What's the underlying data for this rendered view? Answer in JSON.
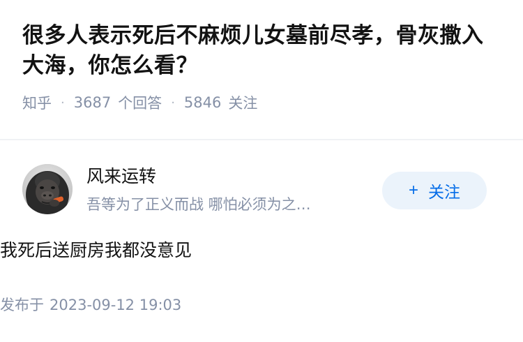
{
  "question": {
    "title": "很多人表示死后不麻烦儿女墓前尽孝，骨灰撒入大海，你怎么看？",
    "source": "知乎",
    "answers_count": "3687",
    "answers_label": "个回答",
    "followers_count": "5846",
    "followers_label": "关注"
  },
  "answer": {
    "author": {
      "name": "风来运转",
      "bio": "吾等为了正义而战 哪怕必须为之…",
      "avatar_icon": "gorilla-avatar-icon"
    },
    "follow_button": {
      "icon": "plus-icon",
      "icon_glyph": "+",
      "label": "关注"
    },
    "content": "我死后送厨房我都没意见",
    "published_label": "发布于",
    "published_time": "2023-09-12 19:03"
  },
  "colors": {
    "primary": "#056de8",
    "follow_bg": "#ebf3fb",
    "meta_text": "#8590a6",
    "title_text": "#121212"
  }
}
